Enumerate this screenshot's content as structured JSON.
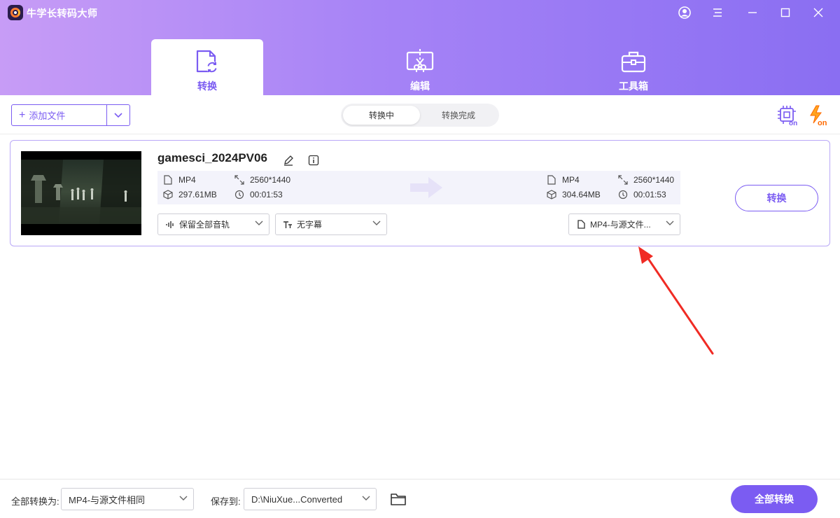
{
  "app": {
    "title": "牛学长转码大师"
  },
  "window": {
    "user_icon": "user-icon",
    "menu_icon": "menu-icon",
    "minimize_icon": "minimize-icon",
    "maximize_icon": "maximize-icon",
    "close_icon": "close-icon"
  },
  "main_tabs": [
    {
      "label": "转换",
      "icon": "convert-icon",
      "active": true
    },
    {
      "label": "编辑",
      "icon": "edit-scissors-icon",
      "active": false
    },
    {
      "label": "工具箱",
      "icon": "toolbox-icon",
      "active": false
    }
  ],
  "toolbar": {
    "add_file_label": "添加文件",
    "status_tabs": [
      {
        "label": "转换中",
        "active": true
      },
      {
        "label": "转换完成",
        "active": false
      }
    ],
    "hw_accel_icon": "gpu-on-icon",
    "speed_icon": "lightning-on-icon",
    "on_text": "on"
  },
  "file": {
    "name": "gamesci_2024PV06",
    "source": {
      "format": "MP4",
      "resolution": "2560*1440",
      "size": "297.61MB",
      "duration": "00:01:53"
    },
    "target": {
      "format": "MP4",
      "resolution": "2560*1440",
      "size": "304.64MB",
      "duration": "00:01:53"
    },
    "audio_select": "保留全部音轨",
    "subtitle_select": "无字幕",
    "format_select": "MP4-与源文件...",
    "convert_label": "转换"
  },
  "footer": {
    "convert_all_as_label": "全部转换为:",
    "convert_all_as_value": "MP4-与源文件相同",
    "save_to_label": "保存到:",
    "save_to_value": "D:\\NiuXue...Converted",
    "convert_all_button": "全部转换"
  },
  "colors": {
    "accent": "#7b5cf2",
    "header_start": "#c79cf6",
    "header_end": "#8a6ef2",
    "annotation": "#f02b24"
  }
}
